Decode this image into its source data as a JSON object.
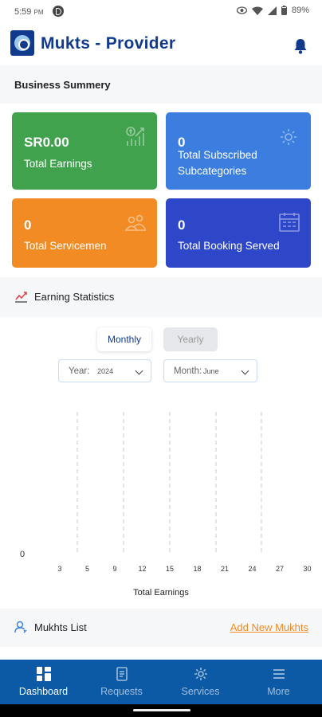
{
  "status_bar": {
    "time": "5:59",
    "time_suffix": "PM",
    "battery": "89%"
  },
  "header": {
    "title": "Mukts - Provider"
  },
  "business_summary": {
    "title": "Business Summery",
    "cards": [
      {
        "value": "SR0.00",
        "label": "Total Earnings",
        "color": "#41a24e",
        "icon": "earnings-chart-icon"
      },
      {
        "value": "0",
        "label_line1": "Total Subscribed",
        "label_line2": "Subcategories",
        "color": "#3b7ee0",
        "icon": "gear-icon"
      },
      {
        "value": "0",
        "label": "Total Servicemen",
        "color": "#f28b23",
        "icon": "servicemen-icon"
      },
      {
        "value": "0",
        "label": "Total Booking Served",
        "color": "#2e47c9",
        "icon": "calendar-icon"
      }
    ]
  },
  "earning_statistics": {
    "title": "Earning Statistics",
    "tabs": [
      {
        "label": "Monthly",
        "active": true
      },
      {
        "label": "Yearly",
        "active": false
      }
    ],
    "year_select": {
      "label": "Year:",
      "value": "2024"
    },
    "month_select": {
      "label": "Month:",
      "value": "June"
    }
  },
  "chart_data": {
    "type": "line",
    "x": [
      3,
      5,
      9,
      12,
      15,
      18,
      21,
      24,
      27,
      30
    ],
    "tick_labels": [
      "3",
      "5",
      "9",
      "12",
      "15",
      "18",
      "21",
      "24",
      "27",
      "30"
    ],
    "y_tick_labels": [
      "0"
    ],
    "series": [
      {
        "values": [
          0,
          0,
          0,
          0,
          0,
          0,
          0,
          0,
          0,
          0
        ]
      }
    ],
    "xlabel": "Total Earnings",
    "grid": "vertical dashed",
    "line_colors": [
      "#e0474c",
      "#1b3fa0"
    ]
  },
  "mukhts_list": {
    "title": "Mukhts List",
    "add_link": "Add New Mukhts"
  },
  "bottom_nav": [
    {
      "label": "Dashboard",
      "active": true,
      "icon": "dashboard-icon"
    },
    {
      "label": "Requests",
      "active": false,
      "icon": "requests-icon"
    },
    {
      "label": "Services",
      "active": false,
      "icon": "services-icon"
    },
    {
      "label": "More",
      "active": false,
      "icon": "menu-icon"
    }
  ]
}
